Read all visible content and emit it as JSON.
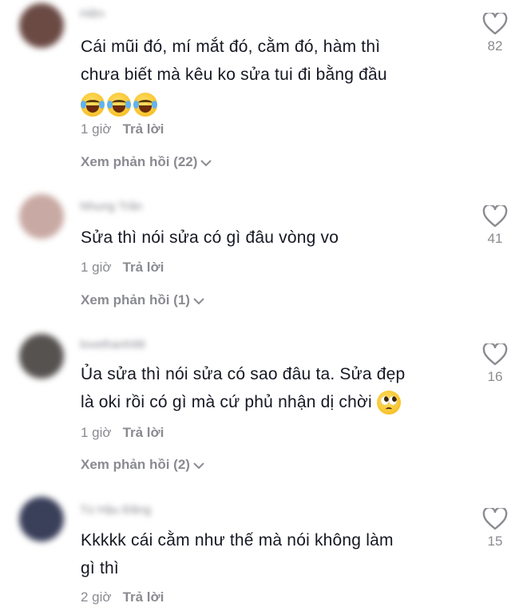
{
  "comments": [
    {
      "username": "Hiền",
      "avatar_color": "#6b4a44",
      "lines": [
        "Cái mũi đó, mí mắt đó, cằm đó, hàm thì",
        "chưa biết mà kêu ko sửa tui đi bằng đầu"
      ],
      "emojis": [
        "laughing-tears",
        "laughing-tears",
        "laughing-tears"
      ],
      "time": "1 giờ",
      "reply_label": "Trả lời",
      "view_replies": "Xem phản hồi (22)",
      "likes": "82"
    },
    {
      "username": "Nhung Trần",
      "avatar_color": "#c9a9a3",
      "lines": [
        "Sửa thì nói sửa có gì đâu vòng vo"
      ],
      "emojis": [],
      "time": "1 giờ",
      "reply_label": "Trả lời",
      "view_replies": "Xem phản hồi (1)",
      "likes": "41"
    },
    {
      "username": "lovethanh98",
      "avatar_color": "#555250",
      "lines": [
        "Ủa sửa thì nói sửa có sao đâu ta. Sửa đẹp",
        "là oki rồi có gì mà cứ phủ nhận dị chời"
      ],
      "emojis": [
        "pleading-face"
      ],
      "time": "1 giờ",
      "reply_label": "Trả lời",
      "view_replies": "Xem phản hồi (2)",
      "likes": "16"
    },
    {
      "username": "Tú Hậu Đăng",
      "avatar_color": "#3a3f5a",
      "lines": [
        "Kkkkk cái cằm như thế mà nói không làm",
        "gì thì"
      ],
      "emojis": [],
      "time": "2 giờ",
      "reply_label": "Trả lời",
      "likes": "15"
    }
  ]
}
